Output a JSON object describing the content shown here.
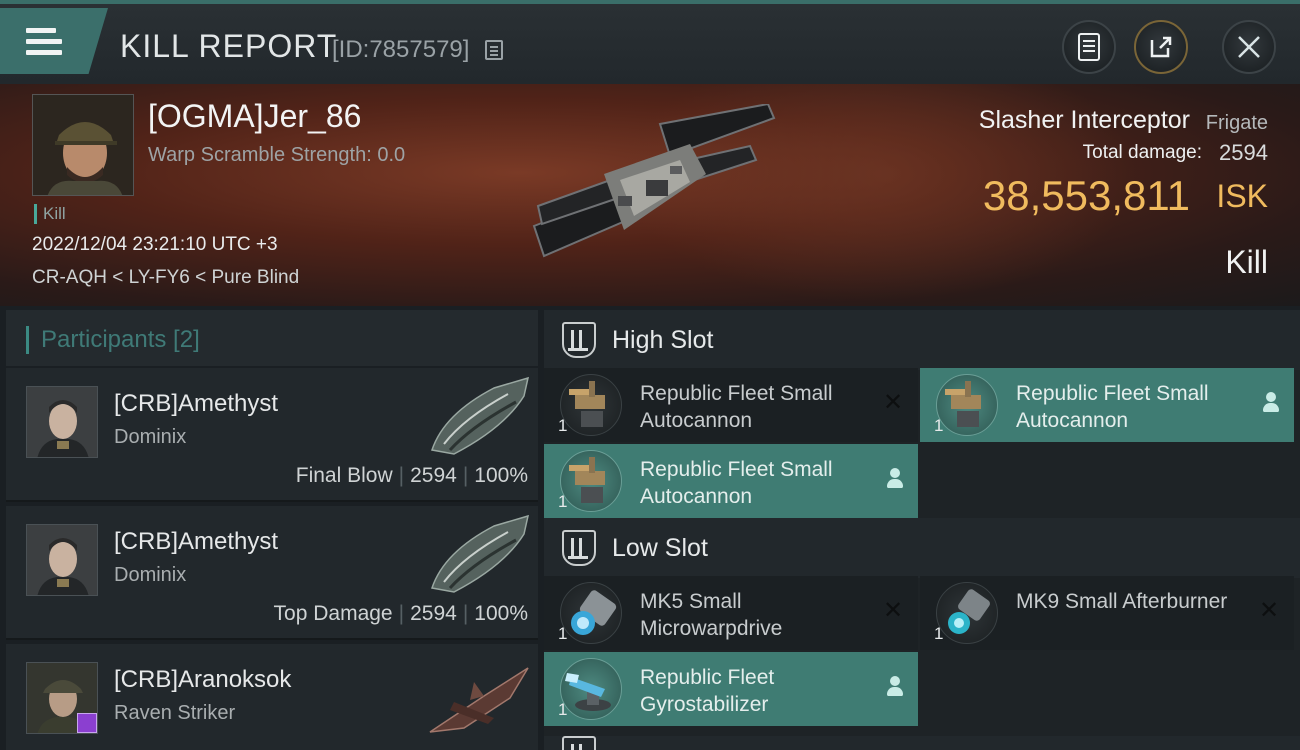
{
  "header": {
    "title": "KILL REPORT",
    "report_id": "[ID:7857579]"
  },
  "victim": {
    "name": "[OGMA]Jer_86",
    "warp_scramble": "Warp Scramble Strength: 0.0",
    "tag": "Kill",
    "datetime": "2022/12/04 23:21:10 UTC +3",
    "location": "CR-AQH < LY-FY6 < Pure Blind",
    "ship_name": "Slasher Interceptor",
    "ship_class": "Frigate",
    "damage_label": "Total damage:",
    "damage_value": "2594",
    "isk_value": "38,553,811",
    "isk_unit": "ISK",
    "result": "Kill"
  },
  "participants": {
    "title": "Participants [2]",
    "items": [
      {
        "name": "[CRB]Amethyst",
        "ship": "Dominix",
        "role": "Final Blow",
        "damage": "2594",
        "percent": "100%"
      },
      {
        "name": "[CRB]Amethyst",
        "ship": "Dominix",
        "role": "Top Damage",
        "damage": "2594",
        "percent": "100%"
      },
      {
        "name": "[CRB]Aranoksok",
        "ship": "Raven Striker"
      }
    ]
  },
  "fitting": {
    "high_slot": {
      "title": "High Slot",
      "modules": [
        {
          "name": "Republic Fleet Small Autocannon",
          "qty": "1",
          "status": "destroyed"
        },
        {
          "name": "Republic Fleet Small Autocannon",
          "qty": "1",
          "status": "dropped"
        },
        {
          "name": "Republic Fleet Small Autocannon",
          "qty": "1",
          "status": "dropped"
        }
      ]
    },
    "low_slot": {
      "title": "Low Slot",
      "modules": [
        {
          "name": "MK5 Small Microwarpdrive",
          "qty": "1",
          "status": "destroyed"
        },
        {
          "name": "MK9 Small Afterburner",
          "qty": "1",
          "status": "destroyed"
        },
        {
          "name": "Republic Fleet Gyrostabilizer",
          "qty": "1",
          "status": "dropped"
        }
      ]
    }
  },
  "colors": {
    "accent_teal": "#3f7c73",
    "isk_gold": "#f0bb5e",
    "banner_red": "#7a3a26"
  },
  "icons": [
    "menu-icon",
    "copy-icon",
    "notes-icon",
    "share-icon",
    "close-icon",
    "slot-icon",
    "person-icon",
    "destroyed-x-icon"
  ]
}
